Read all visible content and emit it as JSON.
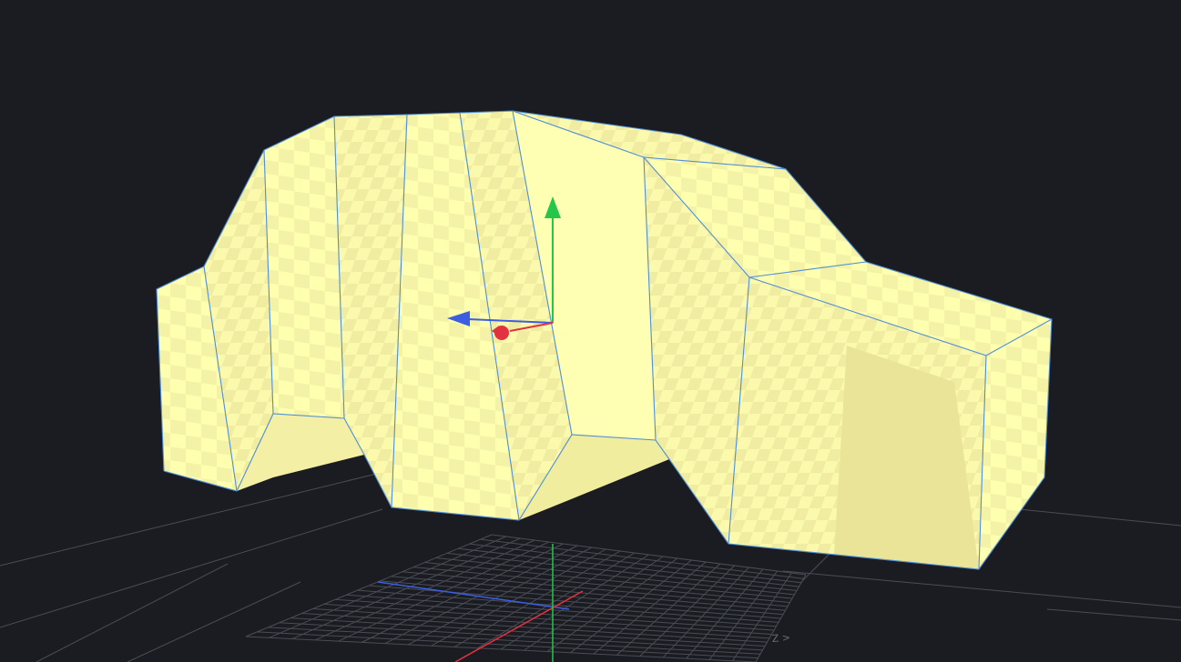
{
  "viewport": {
    "background_color": "#1a1c21",
    "mesh_color": "#ffffb0",
    "mesh_shade_color": "#f2f0a2",
    "mesh_dark_color": "#e9e498",
    "edge_color": "#4f8ed8",
    "grid_color": "#4a4d56",
    "axis_colors": {
      "x": "#e23240",
      "y": "#25c64a",
      "z": "#3b5fe0"
    },
    "axis_label_text": "Z  >"
  },
  "gizmo": {
    "type": "translate",
    "handles": [
      "x-axis-handle",
      "y-axis-handle",
      "z-axis-handle"
    ]
  }
}
